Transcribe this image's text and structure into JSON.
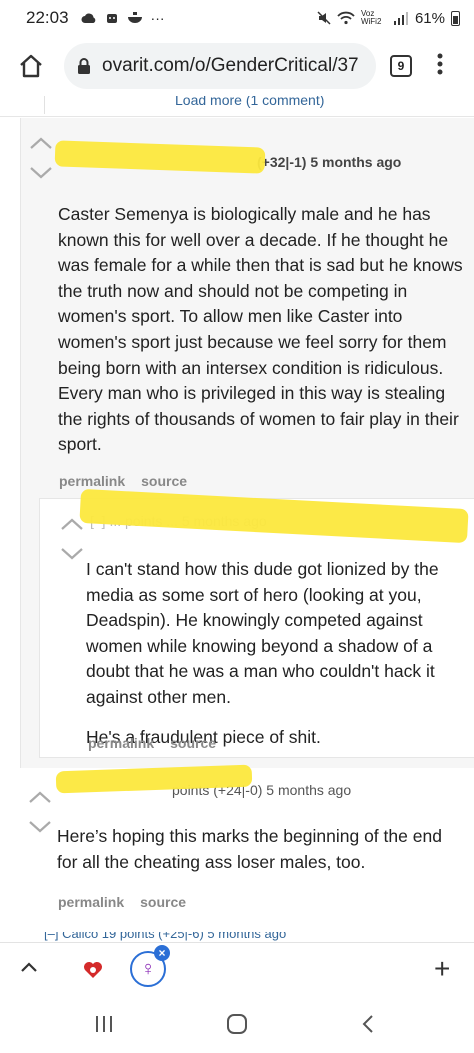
{
  "status_bar": {
    "time": "22:03",
    "left_icons": [
      "cloud-icon",
      "robot-icon",
      "bowl-icon",
      "more-dots-icon"
    ],
    "dots": "···",
    "network_label": "Voz WiFi2",
    "battery": "61%"
  },
  "browser": {
    "url": "ovarit.com/o/GenderCritical/37",
    "tab_count": "9"
  },
  "thread": {
    "load_more": "Load more (1 comment)",
    "comments": [
      {
        "tagline_visible": "(+32|-1) 5 months ago",
        "body": "Caster Semenya is biologically male and he has known this for well over a decade. If he thought he was female for a while then that is sad but he knows the truth now and should not be competing in women's sport. To allow men like Caster into women's sport just because we feel sorry for them being born with an intersex condition is ridiculous. Every man who is privileged in this way is stealing the rights of thousands of women to fair play in their sport.",
        "actions": [
          "permalink",
          "source"
        ]
      },
      {
        "tagline_visible": "[–] ... points ... 5 months ago",
        "body_paragraphs": [
          "I can't stand how this dude got lionized by the media as some sort of hero (looking at you, Deadspin). He knowingly competed against women while knowing beyond a shadow of a doubt that he was a man who couldn't hack it against other men.",
          "He's a fraudulent piece of shit."
        ],
        "actions": [
          "permalink",
          "source"
        ]
      },
      {
        "tagline_visible": "points (+24|-0) 5 months ago",
        "body": "Here’s hoping this marks the beginning of the end for all the cheating ass loser males, too.",
        "actions": [
          "permalink",
          "source"
        ]
      }
    ],
    "next_peek": "[–] Calico 19 points (+25|-6) 5 months ago"
  },
  "toolbar": {
    "plus": "+",
    "favicon_symbol": "♀",
    "close_symbol": "×"
  }
}
